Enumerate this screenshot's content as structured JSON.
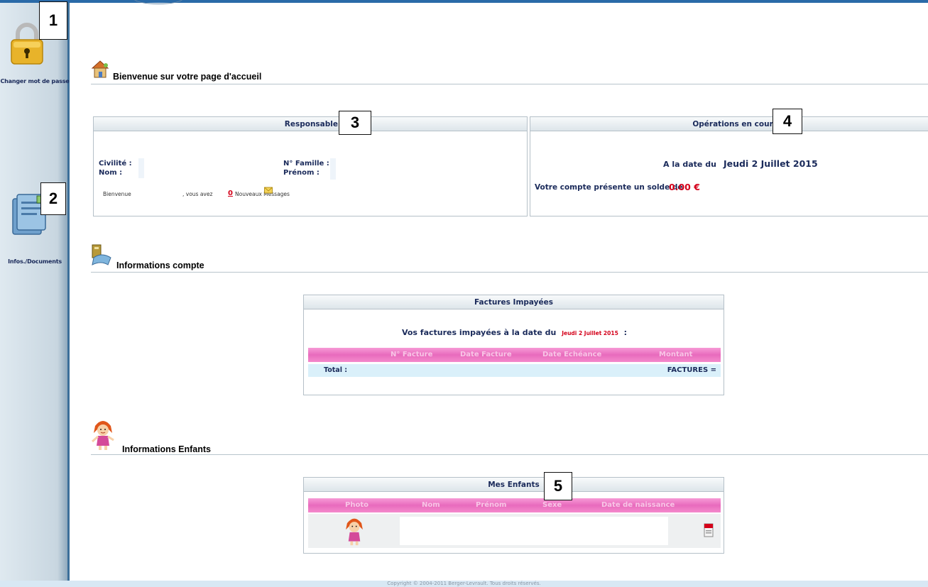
{
  "sidebar": {
    "items": [
      {
        "label": "Changer mot de passe",
        "icon": "padlock-icon",
        "callout": "1"
      },
      {
        "label": "Infos./Documents",
        "icon": "documents-icon",
        "callout": "2"
      }
    ]
  },
  "welcome": {
    "title": "Bienvenue sur votre page d'accueil",
    "icon": "house-icon"
  },
  "responsable": {
    "title": "Responsable",
    "callout": "3",
    "civilite_label": "Civilité :",
    "nom_label": "Nom :",
    "famille_label": "N° Famille :",
    "prenom_label": "Prénom :",
    "welcome_prefix": "Bienvenue",
    "welcome_mid": ", vous avez",
    "message_count": "0",
    "message_suffix": "Nouveaux Messages",
    "message_icon": "envelope-icon"
  },
  "operations": {
    "title": "Opérations en cours",
    "callout": "4",
    "date_prefix": "A la date du",
    "date": "Jeudi 2 Juillet 2015",
    "balance_text": "Votre compte présente un solde de",
    "balance": "0.00 €"
  },
  "account": {
    "title": "Informations compte",
    "icon": "account-book-icon",
    "invoices": {
      "title": "Factures Impayées",
      "subtitle_prefix": "Vos factures impayées à la date du",
      "subtitle_date": "Jeudi 2 Juillet 2015",
      "subtitle_suffix": ":",
      "columns": [
        "N° Facture",
        "Date Facture",
        "Date Echéance",
        "Montant"
      ],
      "total_label": "Total :",
      "total_value": "FACTURES ="
    }
  },
  "children": {
    "title": "Informations Enfants",
    "icon": "child-icon",
    "table": {
      "title": "Mes Enfants",
      "callout": "5",
      "columns": [
        "Photo",
        "Nom",
        "Prénom",
        "Sexe",
        "Date de naissance"
      ],
      "row_icon": "child-photo-icon",
      "pdf_icon": "pdf-icon"
    }
  },
  "footer": {
    "text": "Copyright © 2004-2011 Berger-Levrault. Tous droits réservés."
  },
  "colors": {
    "accent_blue": "#2a6aa8",
    "pink_header": "#e86bbd",
    "balance_red": "#d4001a",
    "title_navy": "#1a2a5a"
  }
}
